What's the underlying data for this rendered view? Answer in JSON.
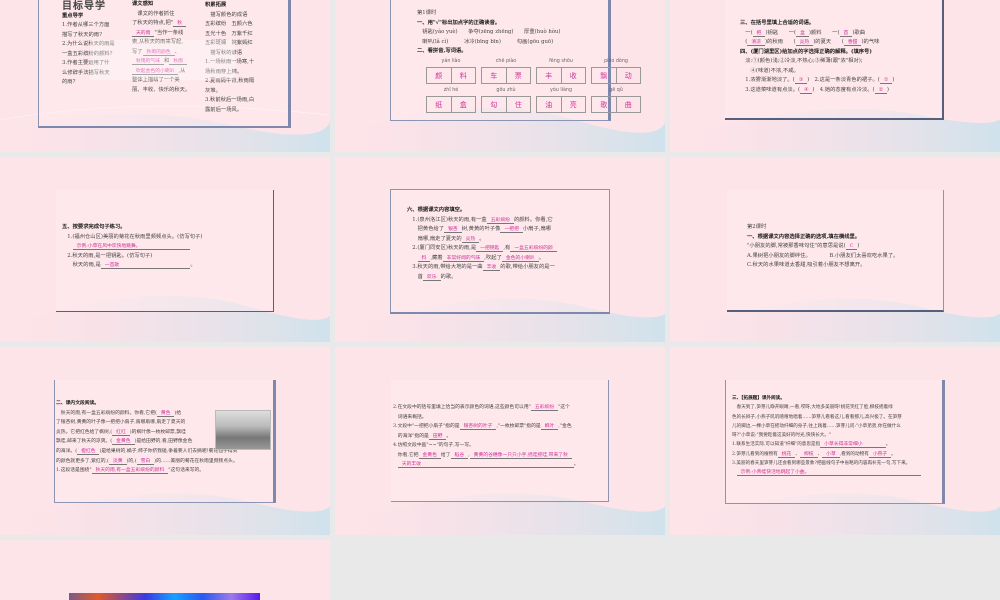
{
  "colors": {
    "page_bg": "#fde4e9",
    "answer": "#d0309a",
    "grid_bg": "#e9e9e9",
    "frame": "#55607e"
  },
  "slides": [
    {
      "title": "目标导学",
      "col1": [
        [
          "重点导学"
        ],
        [
          "1.作者从哪三个方面"
        ],
        [
          "描写了秋天的雨?"
        ],
        [
          "2.为什么说秋天的雨是"
        ],
        [
          "一盒五彩缤纷的颜料?"
        ],
        [
          "3.作者主要运用了什"
        ],
        [
          "么修辞手法描写秋天"
        ],
        [
          "的雨?"
        ]
      ],
      "col2": [
        [
          "课文感知"
        ],
        [
          "　课文的作者抓住"
        ],
        [
          "了秋天的特点,把\"",
          [
            "秋"
          ]
        ],
        [
          [
            "天的雨"
          ],
          "\"当作一条线"
        ],
        [
          "索,从秋天的雨来写起,"
        ],
        [
          "写了",
          [
            "秋雨的颜色"
          ],
          "、"
        ],
        [
          [
            "秋雨的气味"
          ],
          "和",
          [
            "秋雨"
          ]
        ],
        [
          [
            "吹起金色的小喇叭"
          ],
          ",从"
        ],
        [
          "整体上描绘了一个美"
        ],
        [
          "丽、丰收、快乐的秋天。"
        ]
      ],
      "col3": [
        [
          "积累拓展"
        ],
        [
          "　描写颜色的成语"
        ],
        [
          "五彩缤纷　五颜六色"
        ],
        [
          "五光十色　万紫千红"
        ],
        [
          "五彩斑斓　姹紫嫣红"
        ],
        [
          "　描写秋的谚语"
        ],
        [
          "1.一场秋雨一场寒,十"
        ],
        [
          "场秋雨穿上棉。"
        ],
        [
          "2.夏雨隔牛背,秋雨隔"
        ],
        [
          "灰堆。"
        ],
        [
          "3.秋前秋后一场雨,白"
        ],
        [
          "露前后一场风。"
        ]
      ]
    },
    {
      "lines": [
        [
          "第1课时"
        ],
        [
          "一、用\"√\"标出加点字的正确读音。"
        ],
        [
          "　钥匙(yào  yuè)　　争夺(zēng  zhēng)　　厚重(huò  hòu)"
        ],
        [
          "　喇叭(lǎ  cì)　　　冰冷(bīng  bīn)　　　勾画(gōu  guō)"
        ],
        [
          "二、看拼音,写词语。"
        ]
      ],
      "words": [
        {
          "py": "yán liào",
          "chars": "颜料"
        },
        {
          "py": "chē piào",
          "chars": "车票"
        },
        {
          "py": "fēng shōu",
          "chars": "丰收"
        },
        {
          "py": "piāo dòng",
          "chars": "飘动"
        },
        {
          "py": "zhǐ hé",
          "chars": "纸盒"
        },
        {
          "py": "gōu zhù",
          "chars": "勾住"
        },
        {
          "py": "yóu liàng",
          "chars": "油亮"
        },
        {
          "py": "gē qǔ",
          "chars": "歌曲"
        }
      ]
    },
    {
      "lines": [
        [
          "三、在括号里填上合适的词语。"
        ],
        [
          "　一(",
          [
            "把"
          ],
          ")钥匙　　一(",
          [
            "盒"
          ],
          ")颜料　　一(",
          [
            "首"
          ],
          ")歌曲"
        ],
        [
          "　(",
          [
            "清凉"
          ],
          ")的秋雨　　(",
          [
            "炎热"
          ],
          ")的夏天　　(",
          [
            "香甜"
          ],
          ")的气味"
        ],
        [
          "四、(厦门湖里区)给加点的字选择正确的解释。(填序号)"
        ],
        [
          "　淡:①(颜色)浅;②冷淡,不热心;③稀薄(跟\"浓\"相对);"
        ],
        [
          "　　④(味道)不浓,不咸。"
        ],
        [
          "　1.浓雾渐渐地淡了。(",
          [
            "③"
          ],
          ")　2.这是一条淡青色的裙子。(",
          [
            "①"
          ],
          ")"
        ],
        [
          "　3.这道菜味道有点淡。(",
          [
            "④"
          ],
          ")　4.她的态度有点冷淡。(",
          [
            "②"
          ],
          ")"
        ]
      ]
    },
    {
      "lines": [
        [
          "五、按要求完成句子练习。"
        ],
        [
          "　1.(福州仓山区)美丽的菊花在秋雨里频频点头。(仿写句子)"
        ],
        [
          "　　",
          [
            "示例:小草在风中欢快地跳舞。　　　　　　　　　　"
          ]
        ],
        [
          "　2.秋天的雨,是一把钥匙。(仿写句子)"
        ],
        [
          "　　秋天的雨,是",
          [
            "一首歌　　　　　　　　　　　　　　"
          ],
          "。"
        ]
      ]
    },
    {
      "lines": [
        [
          "六、根据课文内容填空。"
        ],
        [
          "　1.(泉州洛江区)秋天的雨,有一盒",
          [
            "五彩缤纷"
          ],
          "的颜料。你看,它"
        ],
        [
          "　　把黄色给了",
          [
            "银杏"
          ],
          "树,黄黄的叶子像",
          [
            "一把把"
          ],
          "小扇子,扇哪"
        ],
        [
          "　　扇哪,扇走了夏天的",
          [
            "炎热"
          ],
          "。"
        ],
        [
          "　2.(厦门同安区)秋天的雨,是",
          [
            "一把钥匙"
          ],
          ",有",
          [
            "一盒五彩缤纷的颜"
          ]
        ],
        [
          "　　",
          [
            "料"
          ],
          ",藏着",
          [
            "非常好闻的气味"
          ],
          ",吹起了",
          [
            "金色的小喇叭"
          ],
          "。"
        ],
        [
          "　3.秋天的雨,带给大地的是一曲",
          [
            "丰收"
          ],
          "的歌,带给小朋友的是一"
        ],
        [
          "　　首",
          [
            "欢乐"
          ],
          "的歌。"
        ]
      ]
    },
    {
      "lines": [
        [
          "第2课时"
        ],
        [
          "一、根据课文内容选择正确的选项,填在横线里。"
        ],
        [
          "\"小朋友的脚,常被那香味勾住\"的意思是说(",
          [
            "C"
          ],
          ")"
        ],
        [
          "A.果树把小朋友的脚绊住。　　　　B.小朋友们太喜欢吃水果了。"
        ],
        [
          "C.秋天的水果味道太香甜,吸引着小朋友不想离开。"
        ]
      ]
    },
    {
      "lines": [
        [
          "二、课内文段阅读。"
        ],
        [
          "　秋天的雨,有一盒五彩缤纷的颜料。你看,它把(",
          [
            "黄色"
          ],
          ")给"
        ],
        [
          "了银杏树,黄黄的叶子像一把把小扇子,扇哪扇哪,扇走了夏天的"
        ],
        [
          "炎热。它把红色给了枫树,(",
          [
            "红红"
          ],
          ")的枫叶像一枚枚邮票,飘哇"
        ],
        [
          "飘哇,邮来了秋天的凉爽。(",
          [
            "金黄色"
          ],
          ")是给田野的,看,田野像金色"
        ],
        [
          "的海洋。(",
          [
            "橙红色"
          ],
          ")是给果树的,橘子,柿子你挤我碰,争着要人们去摘呢!菊花仙子得到"
        ],
        [
          "的颜色就更多了,紫红的,(",
          [
            "淡黄"
          ],
          ")的,(",
          [
            "雪白"
          ],
          ")的……美丽的菊花在秋雨里频频点头。"
        ],
        [
          "1.这段话是围绕\"",
          [
            "秋天的雨,有一盒五彩缤纷的颜料"
          ],
          "\"这句话来写的。"
        ]
      ]
    },
    {
      "lines": [
        [
          "2.在文段中的括号里填上恰当的表示颜色的词语,这些颜色可以用\"",
          [
            "五彩缤纷"
          ],
          "\"这个"
        ],
        [
          "　词语来概括。"
        ],
        [
          "3.文段中\"一把把小扇子\"指的是",
          [
            "银杏树的叶子"
          ],
          ",\"一枚枚邮票\"指的是",
          [
            "枫叶"
          ],
          ",\"金色"
        ],
        [
          "　的海洋\"指的是",
          [
            "田野"
          ],
          "。"
        ],
        [
          "4.仿照文段中画\"~~\"的句子,写一写。"
        ],
        [
          "　你看,它把",
          [
            "金黄色"
          ],
          "给了",
          [
            "稻谷"
          ],
          ",",
          [
            "黄黄的谷穗像一只只小手,摇哇摇哇,带来了秋"
          ]
        ],
        [
          "　",
          [
            "天的丰收　　　　　　　　　　　　　　　　　　　　　　　　　　　　　　　"
          ],
          "。"
        ]
      ]
    },
    {
      "lines": [
        [
          "三、【拓展题】课外阅读。"
        ],
        [
          "　春天到了,笋芽儿睁开眼睛,一看,哎呀,大地多美丽呀!桃花笑红了脸,柳枝摇着绿"
        ],
        [
          "色的长辫子,小燕子叽叽喳喳地唱着……笋芽儿看看这儿,看看那儿,高兴极了。在笋芽"
        ],
        [
          "儿的脚边,一棵小草在摇动纤细的身子,往上践着……笋芽儿问:\"小草弟弟,你在做什么"
        ],
        [
          "呀?\"小草说:\"我要趁着这美好的时光,快快长大。\""
        ],
        [
          "1.联系生活实际,可以知道\"纤细\"的意思是指",
          [
            "小草长得非常细小　　　　"
          ],
          "。"
        ],
        [
          "2.笋芽儿看到的植物有",
          [
            "桃花"
          ],
          "、",
          [
            "柳枝"
          ],
          "、",
          [
            "小草"
          ],
          ",看到的动物有",
          [
            "小燕子"
          ],
          "。"
        ],
        [
          "3.美丽的春天里笋芽儿还会看到哪些景象?把画线句子中省略的内容再补充一句,写下来。"
        ],
        [
          "　",
          [
            "示例:小青蛙快活地跳起了小曲。　　　　　　　　　　　　　　　　　　　　　　　"
          ]
        ]
      ]
    },
    {}
  ]
}
